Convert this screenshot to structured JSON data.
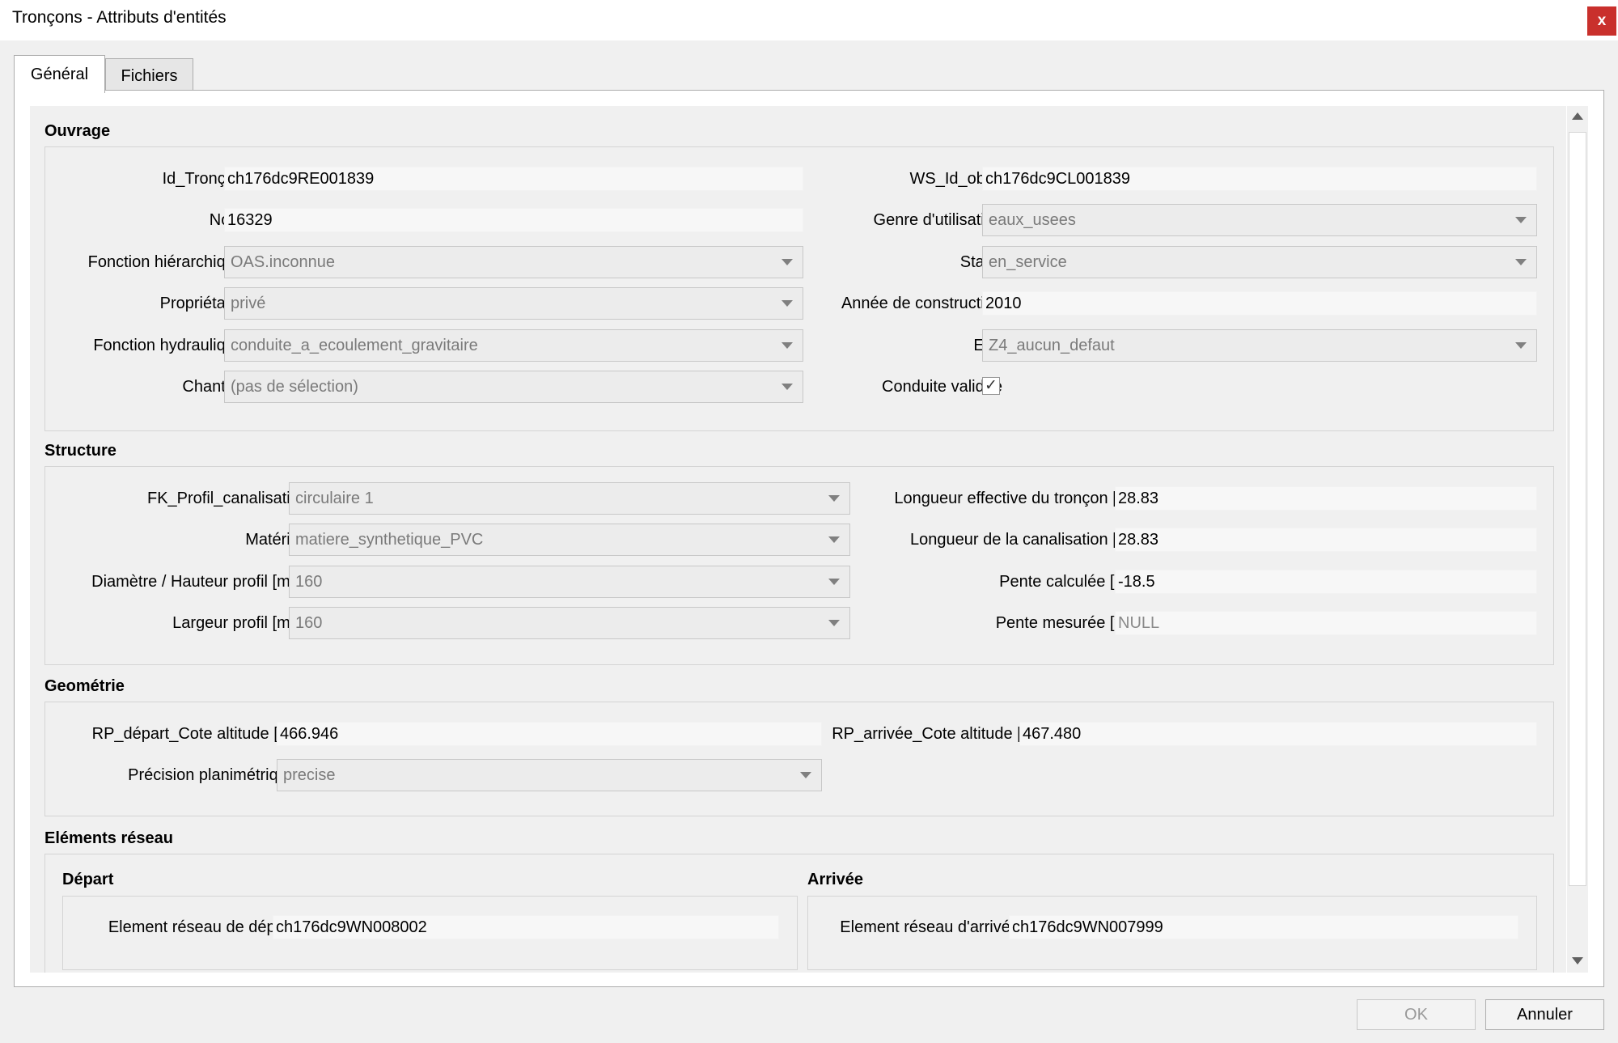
{
  "window": {
    "title": "Tronçons - Attributs d'entités",
    "close_label": "x"
  },
  "tabs": [
    {
      "label": "Général",
      "active": true
    },
    {
      "label": "Fichiers",
      "active": false
    }
  ],
  "ouvrage": {
    "title": "Ouvrage",
    "id_troncon": {
      "label": "Id_Tronçon",
      "value": "ch176dc9RE001839"
    },
    "nom": {
      "label": "Nom",
      "value": "16329"
    },
    "fonction_hierarchique": {
      "label": "Fonction hiérarchique",
      "value": "OAS.inconnue"
    },
    "proprietaire": {
      "label": "Propriétaire",
      "value": "privé"
    },
    "fonction_hydraulique": {
      "label": "Fonction hydraulique",
      "value": "conduite_a_ecoulement_gravitaire"
    },
    "chantier": {
      "label": "Chantier",
      "value": "(pas de sélection)"
    },
    "ws_id_objet": {
      "label": "WS_Id_objet",
      "value": "ch176dc9CL001839"
    },
    "genre_utilisation": {
      "label": "Genre d'utilisation",
      "value": "eaux_usees"
    },
    "statut": {
      "label": "Statut",
      "value": "en_service"
    },
    "annee_construction": {
      "label": "Année de construction",
      "value": "2010"
    },
    "etat": {
      "label": "Etat",
      "value": "Z4_aucun_defaut"
    },
    "conduite_validee": {
      "label": "Conduite validée",
      "checked": true,
      "mark": "✓"
    }
  },
  "structure": {
    "title": "Structure",
    "fk_profil": {
      "label": "FK_Profil_canalisation",
      "value": "circulaire 1"
    },
    "materiau": {
      "label": "Matériau",
      "value": "matiere_synthetique_PVC"
    },
    "diametre": {
      "label": "Diamètre / Hauteur profil [mm]",
      "value": "160"
    },
    "largeur": {
      "label": "Largeur profil [mm]",
      "value": "160"
    },
    "longueur_effective": {
      "label": "Longueur effective du tronçon [m]",
      "value": "28.83"
    },
    "longueur_canalisation": {
      "label": "Longueur de la canalisation [m]",
      "value": "28.83"
    },
    "pente_calculee": {
      "label": "Pente calculée [‰]",
      "value": "-18.5"
    },
    "pente_mesuree": {
      "label": "Pente mesurée [‰]",
      "value": "NULL"
    }
  },
  "geometrie": {
    "title": "Geométrie",
    "rp_depart": {
      "label": "RP_départ_Cote altitude [m]",
      "value": "466.946"
    },
    "rp_arrivee": {
      "label": "RP_arrivée_Cote altitude [m]",
      "value": "467.480"
    },
    "precision": {
      "label": "Précision planimétrique",
      "value": "precise"
    }
  },
  "elements_reseau": {
    "title": "Eléments réseau",
    "depart": {
      "title": "Départ",
      "label": "Element réseau de départ",
      "value": "ch176dc9WN008002"
    },
    "arrivee": {
      "title": "Arrivée",
      "label": "Element réseau d'arrivée",
      "value": "ch176dc9WN007999"
    }
  },
  "buttons": {
    "ok": "OK",
    "cancel": "Annuler"
  }
}
